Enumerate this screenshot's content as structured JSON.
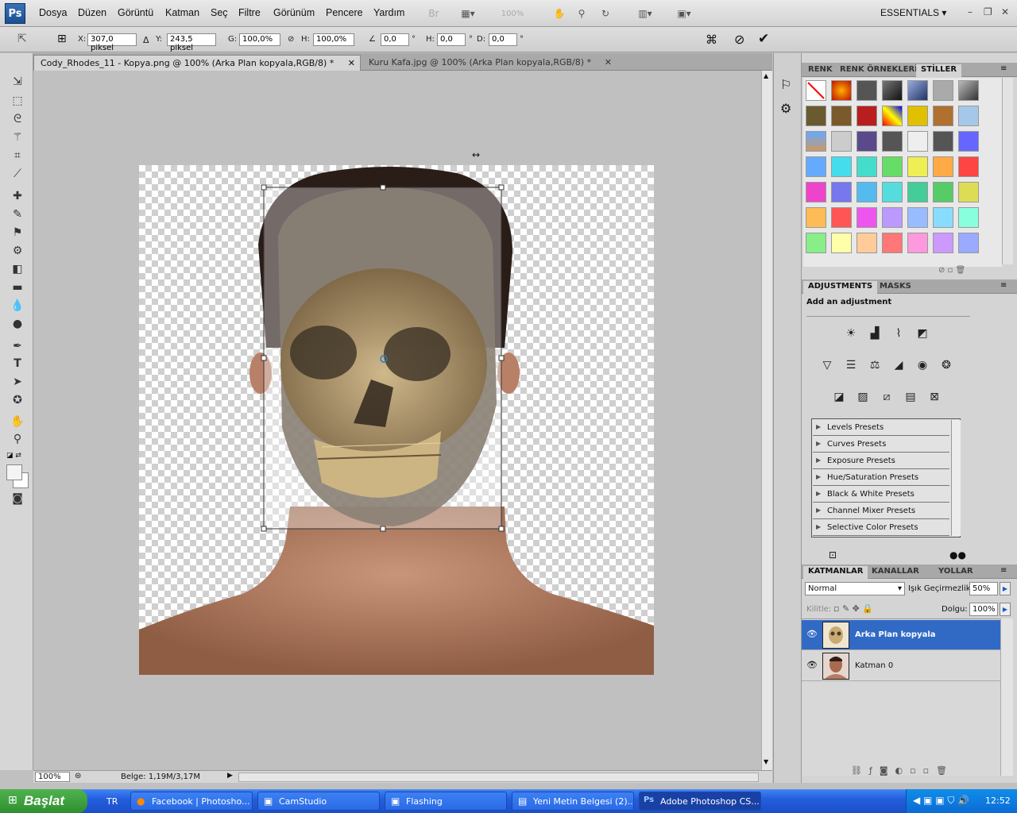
{
  "app": {
    "logo": "Ps",
    "workspace": "ESSENTIALS"
  },
  "menu": [
    "Dosya",
    "Düzen",
    "Görüntü",
    "Katman",
    "Seç",
    "Filtre",
    "Görünüm",
    "Pencere",
    "Yardım"
  ],
  "toolbar": {
    "zoom": "100%"
  },
  "options": {
    "x_label": "X:",
    "x_value": "307,0 piksel",
    "y_label": "Y:",
    "y_value": "243,5 piksel",
    "w_label": "G:",
    "w_value": "100,0%",
    "h_label": "H:",
    "h_value": "100,0%",
    "angle_value": "0,0",
    "hskew_label": "H:",
    "hskew_value": "0,0",
    "vskew_label": "D:",
    "vskew_value": "0,0",
    "deg": "°"
  },
  "tabs": [
    {
      "label": "Cody_Rhodes_11 - Kopya.png @ 100% (Arka Plan kopyala,RGB/8) *",
      "active": true
    },
    {
      "label": "Kuru Kafa.jpg @ 100% (Arka Plan kopyala,RGB/8) *",
      "active": false
    }
  ],
  "status": {
    "zoom": "100%",
    "doc": "Belge: 1,19M/3,17M"
  },
  "colorpanel": {
    "tabs": [
      "RENK",
      "RENK ÖRNEKLERİ",
      "STİLLER"
    ],
    "active": 2
  },
  "adjustments": {
    "tabs": [
      "ADJUSTMENTS",
      "MASKS"
    ],
    "title": "Add an adjustment",
    "presets": [
      "Levels Presets",
      "Curves Presets",
      "Exposure Presets",
      "Hue/Saturation Presets",
      "Black & White Presets",
      "Channel Mixer Presets",
      "Selective Color Presets"
    ]
  },
  "layers": {
    "tabs": [
      "KATMANLAR",
      "KANALLAR",
      "YOLLAR"
    ],
    "blend": "Normal",
    "opacity_label": "Işık Geçirmezlik:",
    "opacity": "50%",
    "lock_label": "Kilitle:",
    "fill_label": "Dolgu:",
    "fill": "100%",
    "items": [
      {
        "name": "Arka Plan kopyala",
        "selected": true
      },
      {
        "name": "Katman 0",
        "selected": false
      }
    ]
  },
  "taskbar": {
    "start": "Başlat",
    "lang": "TR",
    "time": "12:52",
    "tasks": [
      "Facebook | Photosho...",
      "CamStudio",
      "Flashing",
      "Yeni Metin Belgesi (2)...",
      "Adobe Photoshop CS..."
    ]
  },
  "colors": {
    "accent": "#316ac5",
    "taskbar": "#245edc",
    "start": "#3a9a3a"
  }
}
